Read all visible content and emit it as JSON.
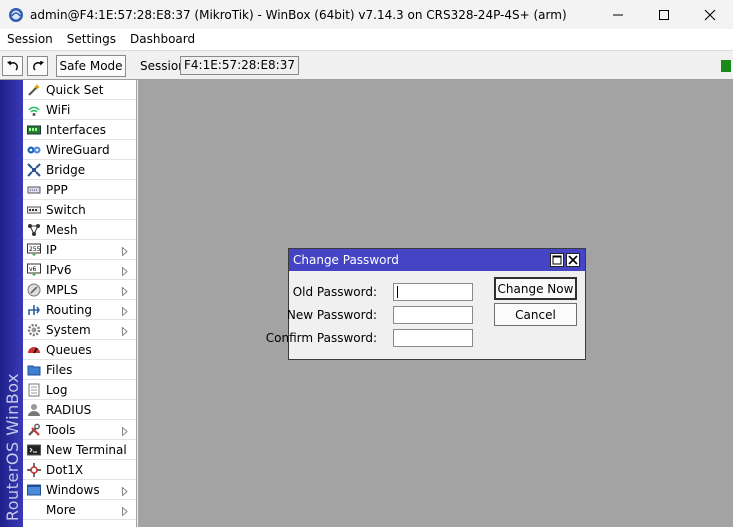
{
  "window": {
    "title": "admin@F4:1E:57:28:E8:37 (MikroTik) - WinBox (64bit) v7.14.3 on CRS328-24P-4S+ (arm)"
  },
  "menu": [
    "Session",
    "Settings",
    "Dashboard"
  ],
  "toolbar": {
    "safe_mode_label": "Safe Mode",
    "session_label": "Session:",
    "session_value": "F4:1E:57:28:E8:37"
  },
  "brand": "RouterOS WinBox",
  "sidebar": {
    "items": [
      {
        "label": "Quick Set",
        "icon": "wand-icon",
        "submenu": false
      },
      {
        "label": "WiFi",
        "icon": "wifi-icon",
        "submenu": false
      },
      {
        "label": "Interfaces",
        "icon": "interfaces-icon",
        "submenu": false
      },
      {
        "label": "WireGuard",
        "icon": "wireguard-icon",
        "submenu": false
      },
      {
        "label": "Bridge",
        "icon": "bridge-icon",
        "submenu": false
      },
      {
        "label": "PPP",
        "icon": "ppp-icon",
        "submenu": false
      },
      {
        "label": "Switch",
        "icon": "switch-icon",
        "submenu": false
      },
      {
        "label": "Mesh",
        "icon": "mesh-icon",
        "submenu": false
      },
      {
        "label": "IP",
        "icon": "ip-icon",
        "submenu": true
      },
      {
        "label": "IPv6",
        "icon": "ipv6-icon",
        "submenu": true
      },
      {
        "label": "MPLS",
        "icon": "mpls-icon",
        "submenu": true
      },
      {
        "label": "Routing",
        "icon": "routing-icon",
        "submenu": true
      },
      {
        "label": "System",
        "icon": "system-gear-icon",
        "submenu": true
      },
      {
        "label": "Queues",
        "icon": "queues-icon",
        "submenu": false
      },
      {
        "label": "Files",
        "icon": "folder-icon",
        "submenu": false
      },
      {
        "label": "Log",
        "icon": "log-icon",
        "submenu": false
      },
      {
        "label": "RADIUS",
        "icon": "radius-icon",
        "submenu": false
      },
      {
        "label": "Tools",
        "icon": "tools-icon",
        "submenu": true
      },
      {
        "label": "New Terminal",
        "icon": "terminal-icon",
        "submenu": false
      },
      {
        "label": "Dot1X",
        "icon": "dot1x-icon",
        "submenu": false
      },
      {
        "label": "Windows",
        "icon": "windows-icon",
        "submenu": true
      },
      {
        "label": "More",
        "icon": "",
        "submenu": true
      }
    ]
  },
  "dialog": {
    "title": "Change Password",
    "fields": [
      {
        "label": "Old Password:",
        "value": ""
      },
      {
        "label": "New Password:",
        "value": ""
      },
      {
        "label": "Confirm Password:",
        "value": ""
      }
    ],
    "change_now_label": "Change Now",
    "cancel_label": "Cancel"
  },
  "colors": {
    "dialog_title_bg": "#4444c4",
    "workspace_bg": "#a3a3a3",
    "brand_strip": "#2a2aa0",
    "status_led": "#1a8a1a"
  }
}
